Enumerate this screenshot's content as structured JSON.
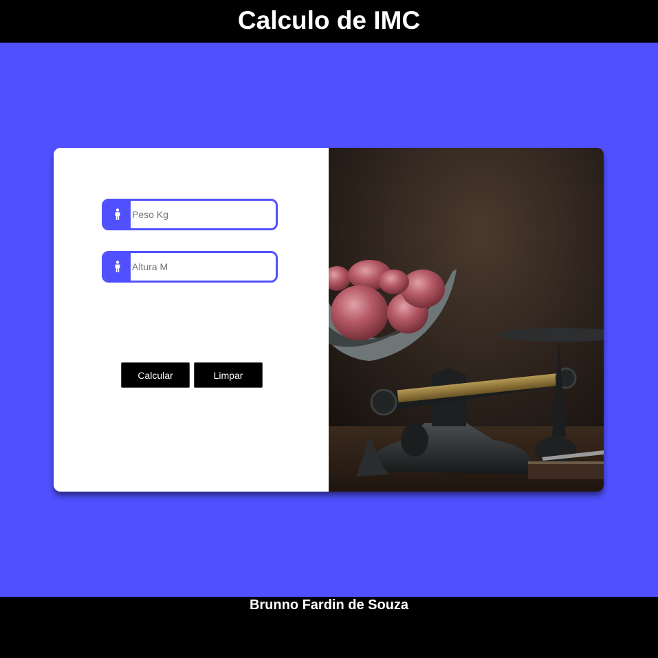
{
  "header": {
    "title": "Calculo de IMC"
  },
  "form": {
    "weight": {
      "placeholder": "Peso Kg",
      "value": "",
      "icon": "person-icon"
    },
    "height": {
      "placeholder": "Altura M",
      "value": "",
      "icon": "person-icon"
    },
    "calculate_label": "Calcular",
    "clear_label": "Limpar"
  },
  "image": {
    "subject": "potatoes on vintage kitchen scale"
  },
  "footer": {
    "author": "Brunno Fardin de Souza"
  },
  "colors": {
    "accent": "#5050fe",
    "header_bg": "#000000",
    "card_bg": "#ffffff",
    "button_bg": "#000000"
  }
}
